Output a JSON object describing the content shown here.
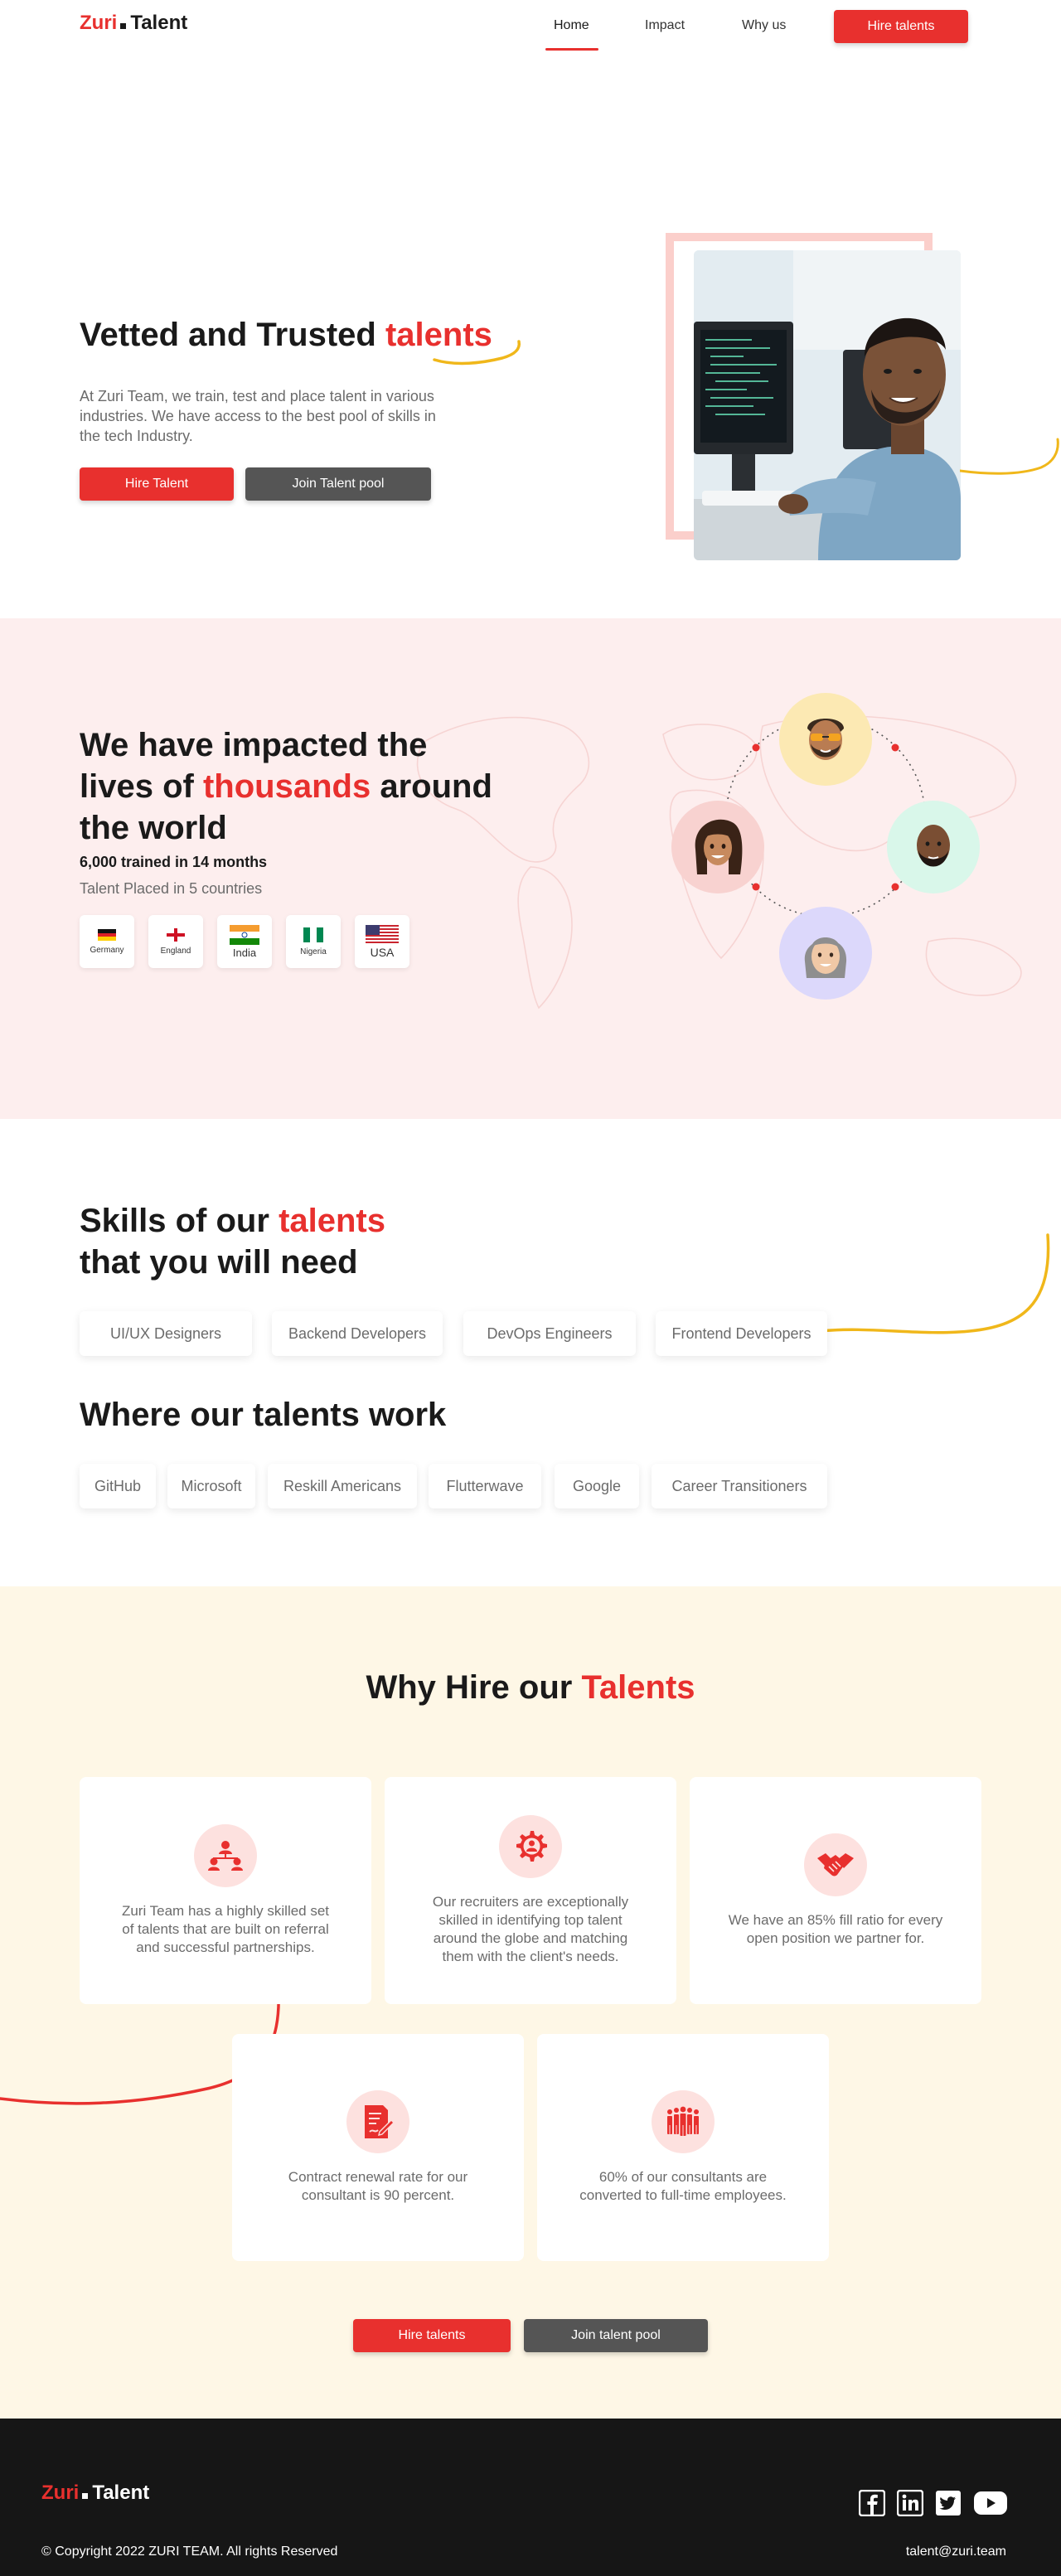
{
  "brand": {
    "name_first": "Zuri",
    "name_second": "Talent"
  },
  "nav": {
    "links": [
      "Home",
      "Impact",
      "Why us"
    ],
    "cta": "Hire talents"
  },
  "hero": {
    "title_plain": "Vetted and Trusted",
    "title_highlight": "talents",
    "description": "At Zuri Team, we train, test and place talent in various industries. We have access to the best pool of skills in the tech Industry.",
    "primary_button": "Hire Talent",
    "secondary_button": "Join Talent pool"
  },
  "impact": {
    "title_line1": "We have impacted the",
    "title_line2_pre": "lives of",
    "title_line2_highlight": "thousands",
    "title_line2_post": "around",
    "title_line3": "the world",
    "stat": "6,000 trained in 14 months",
    "subtitle": "Talent Placed in 5 countries",
    "countries": [
      "Germany",
      "England",
      "India",
      "Nigeria",
      "USA"
    ]
  },
  "skills": {
    "title_pre": "Skills of our",
    "title_highlight": "talents",
    "title_line2": "that you will need",
    "items": [
      "UI/UX Designers",
      "Backend Developers",
      "DevOps Engineers",
      "Frontend Developers"
    ]
  },
  "work": {
    "title": "Where our talents work",
    "items": [
      "GitHub",
      "Microsoft",
      "Reskill Americans",
      "Flutterwave",
      "Google",
      "Career Transitioners"
    ]
  },
  "why": {
    "title_pre": "Why Hire our",
    "title_highlight": "Talents",
    "cards": [
      {
        "icon": "network-people-icon",
        "text": "Zuri Team has a highly skilled set of talents that are built on referral and successful partnerships."
      },
      {
        "icon": "gear-person-icon",
        "text": "Our recruiters are exceptionally skilled in identifying top talent around the globe and matching them with the client's needs."
      },
      {
        "icon": "handshake-icon",
        "text": "We have an 85% fill ratio for every open position we partner for."
      },
      {
        "icon": "contract-icon",
        "text": "Contract renewal rate for our consultant is 90 percent."
      },
      {
        "icon": "team-icon",
        "text": "60% of our consultants are converted to full-time employees."
      }
    ],
    "primary_button": "Hire talents",
    "secondary_button": "Join talent pool"
  },
  "footer": {
    "copyright": "© Copyright 2022 ZURI TEAM. All rights Reserved",
    "email": "talent@zuri.team",
    "socials": [
      "facebook-icon",
      "linkedin-icon",
      "twitter-icon",
      "youtube-icon"
    ]
  },
  "colors": {
    "accent": "#e8302e",
    "dark_button": "#555555",
    "impact_bg": "#fdeeee",
    "why_bg": "#fef7e6",
    "footer_bg": "#161616",
    "wave": "#f0b71a"
  }
}
